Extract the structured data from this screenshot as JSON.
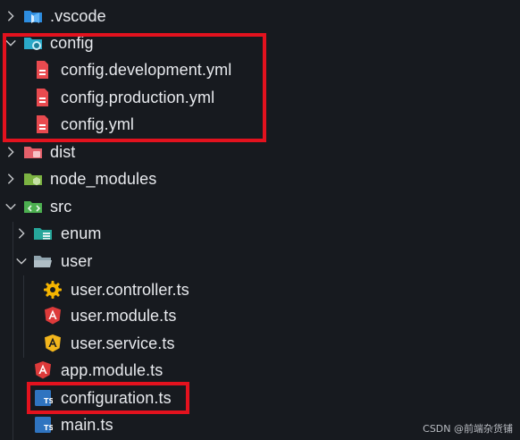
{
  "tree": {
    "vscode": ".vscode",
    "config": "config",
    "config_dev": "config.development.yml",
    "config_prod": "config.production.yml",
    "config_yml": "config.yml",
    "dist": "dist",
    "node_modules": "node_modules",
    "src": "src",
    "enum": "enum",
    "user": "user",
    "user_controller": "user.controller.ts",
    "user_module": "user.module.ts",
    "user_service": "user.service.ts",
    "app_module": "app.module.ts",
    "configuration": "configuration.ts",
    "main": "main.ts"
  },
  "icons": {
    "vscode": "vscode-folder-icon",
    "config": "config-folder-icon",
    "yml": "yaml-file-icon",
    "dist": "dist-folder-icon",
    "node_modules": "node-modules-folder-icon",
    "src": "src-folder-icon",
    "enum": "enum-folder-icon",
    "user": "folder-open-icon",
    "controller": "gear-icon",
    "angular": "angular-icon",
    "ts": "typescript-file-icon"
  },
  "colors": {
    "background": "#171a1f",
    "highlight": "#e3121e",
    "yaml": "#e84a4f",
    "typescript": "#2f74c0"
  },
  "watermark": "CSDN @前端杂货铺"
}
